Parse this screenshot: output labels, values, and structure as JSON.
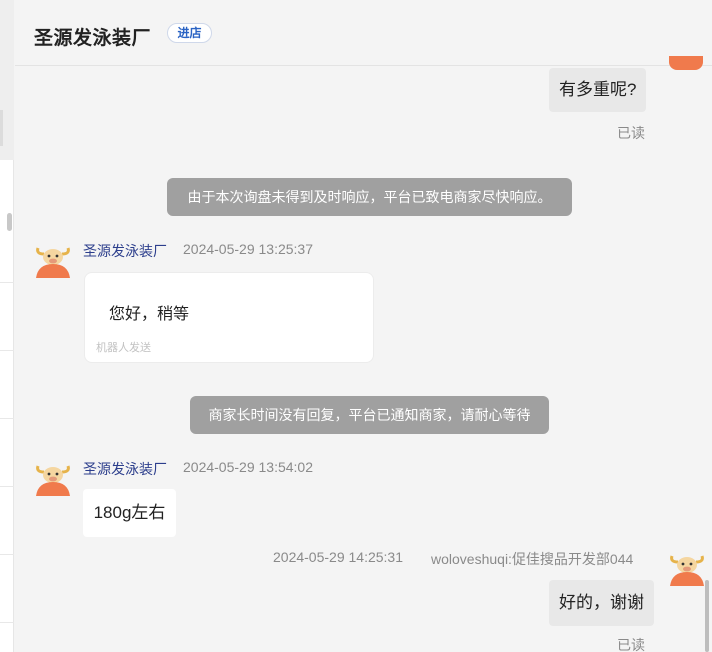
{
  "header": {
    "shop_name": "圣源发泳装厂",
    "enter_store_label": "进店"
  },
  "messages": {
    "m1": {
      "text": "有多重呢?",
      "status": "已读"
    },
    "sys1": {
      "text": "由于本次询盘未得到及时响应，平台已致电商家尽快响应。"
    },
    "m2": {
      "sender": "圣源发泳装厂",
      "time": "2024-05-29 13:25:37",
      "text": "您好，稍等",
      "note": "机器人发送"
    },
    "sys2": {
      "text": "商家长时间没有回复，平台已通知商家，请耐心等待"
    },
    "m3": {
      "sender": "圣源发泳装厂",
      "time": "2024-05-29 13:54:02",
      "text": "180g左右"
    },
    "m4": {
      "time": "2024-05-29 14:25:31",
      "sender": "woloveshuqi:促佳搜品开发部044",
      "text": "好的，谢谢",
      "status": "已读"
    }
  },
  "colors": {
    "accent": "#2a63c4",
    "sender": "#2c3e8c",
    "avatar": "#f07a4c",
    "system_bubble": "#a0a0a0"
  },
  "icons": {
    "avatar_merchant": "bull-mascot-icon",
    "avatar_user": "bull-mascot-icon"
  }
}
